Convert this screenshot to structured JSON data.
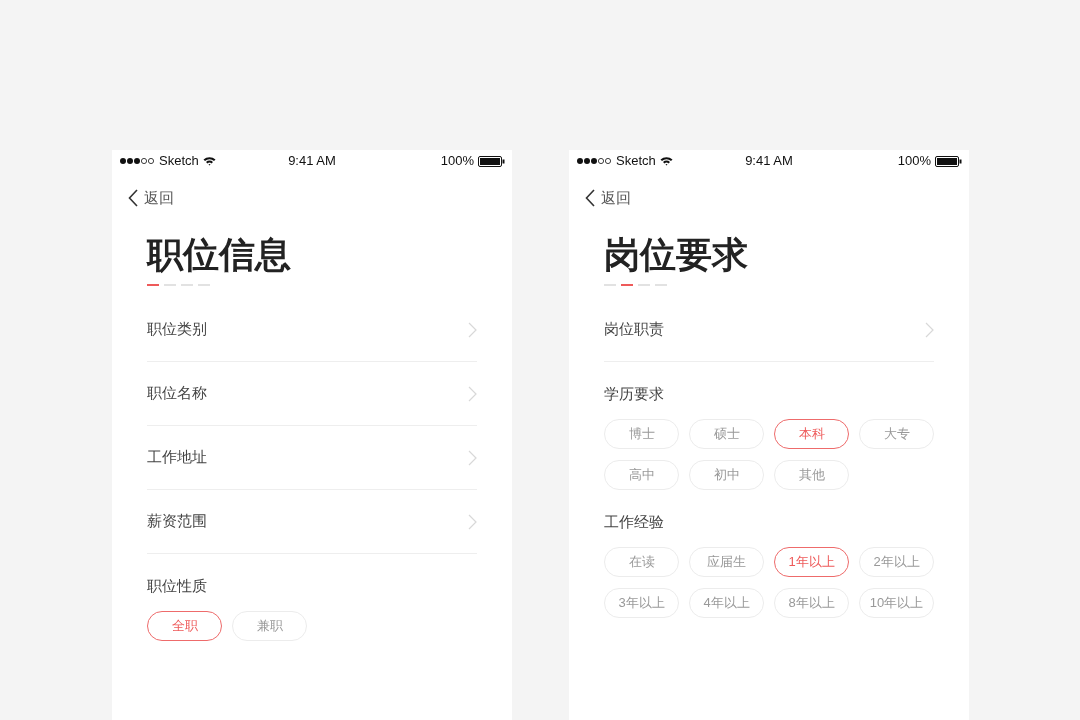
{
  "screens": [
    {
      "status_bar": {
        "carrier": "Sketch",
        "time": "9:41 AM",
        "battery": "100%"
      },
      "back": "返回",
      "title": "职位信息",
      "steps": [
        {
          "selected": true
        },
        {
          "selected": false
        },
        {
          "selected": false
        },
        {
          "selected": false
        }
      ],
      "sections": [
        {
          "kind": "nav",
          "label": "职位类别"
        },
        {
          "kind": "nav",
          "label": "职位名称"
        },
        {
          "kind": "nav",
          "label": "工作地址"
        },
        {
          "kind": "nav",
          "label": "薪资范围"
        },
        {
          "kind": "chips",
          "label": "职位性质",
          "options": [
            {
              "label": "全职",
              "selected": true
            },
            {
              "label": "兼职",
              "selected": false
            }
          ]
        }
      ]
    },
    {
      "status_bar": {
        "carrier": "Sketch",
        "time": "9:41 AM",
        "battery": "100%"
      },
      "back": "返回",
      "title": "岗位要求",
      "steps": [
        {
          "selected": false
        },
        {
          "selected": true
        },
        {
          "selected": false
        },
        {
          "selected": false
        }
      ],
      "sections": [
        {
          "kind": "nav",
          "label": "岗位职责"
        },
        {
          "kind": "chips",
          "label": "学历要求",
          "options": [
            {
              "label": "博士",
              "selected": false
            },
            {
              "label": "硕士",
              "selected": false
            },
            {
              "label": "本科",
              "selected": true
            },
            {
              "label": "大专",
              "selected": false
            },
            {
              "label": "高中",
              "selected": false
            },
            {
              "label": "初中",
              "selected": false
            },
            {
              "label": "其他",
              "selected": false
            }
          ]
        },
        {
          "kind": "chips",
          "label": "工作经验",
          "options": [
            {
              "label": "在读",
              "selected": false
            },
            {
              "label": "应届生",
              "selected": false
            },
            {
              "label": "1年以上",
              "selected": true
            },
            {
              "label": "2年以上",
              "selected": false
            },
            {
              "label": "3年以上",
              "selected": false
            },
            {
              "label": "4年以上",
              "selected": false
            },
            {
              "label": "8年以上",
              "selected": false
            },
            {
              "label": "10年以上",
              "selected": false
            }
          ]
        }
      ]
    }
  ]
}
